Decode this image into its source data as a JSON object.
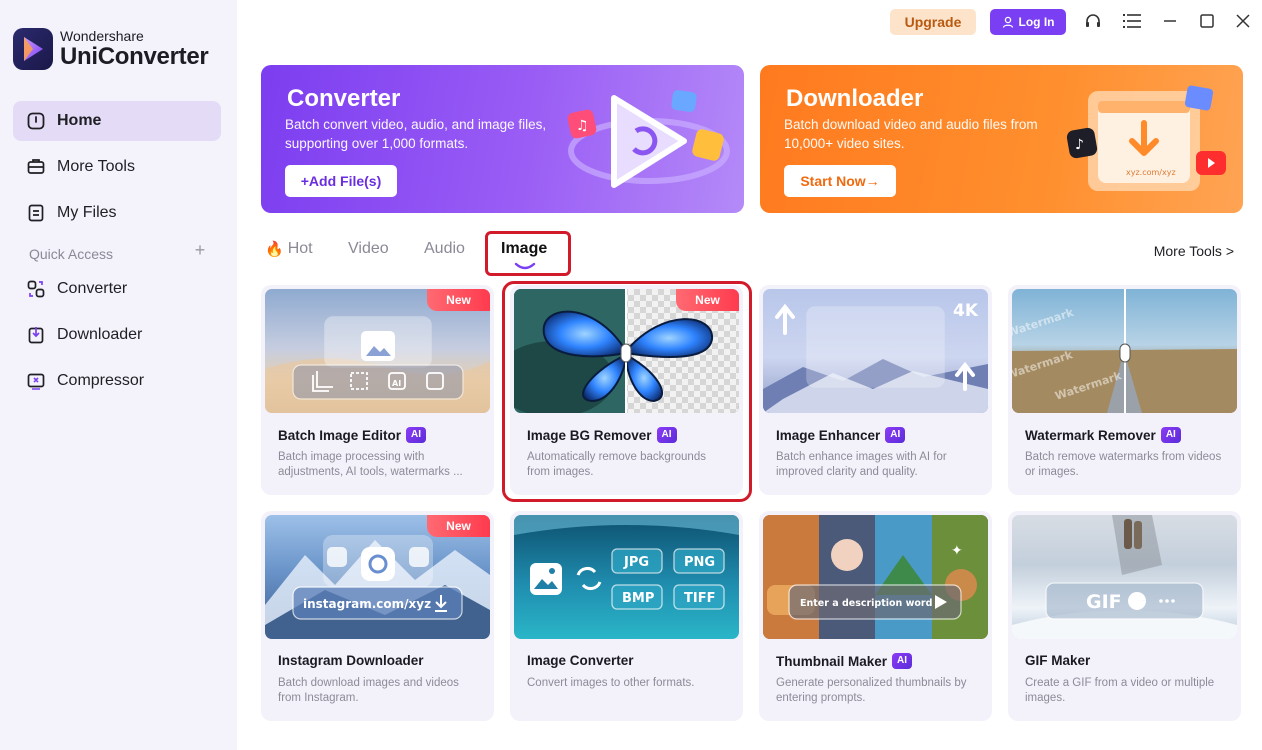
{
  "app": {
    "brand": "Wondershare",
    "product": "UniConverter"
  },
  "titlebar": {
    "upgrade_label": "Upgrade",
    "login_label": "Log In",
    "icons": [
      "headset-icon",
      "menu-icon",
      "minimize-icon",
      "maximize-icon",
      "close-icon"
    ]
  },
  "sidebar": {
    "items": [
      {
        "label": "Home",
        "icon": "home-icon",
        "active": true
      },
      {
        "label": "More Tools",
        "icon": "toolbox-icon"
      },
      {
        "label": "My Files",
        "icon": "files-icon"
      }
    ],
    "quick_access_label": "Quick Access",
    "quick_access_add": "+",
    "quick_items": [
      {
        "label": "Converter",
        "icon": "converter-icon"
      },
      {
        "label": "Downloader",
        "icon": "downloader-icon"
      },
      {
        "label": "Compressor",
        "icon": "compressor-icon"
      }
    ]
  },
  "banners": {
    "converter": {
      "title": "Converter",
      "description": "Batch convert video, audio, and image files, supporting over 1,000 formats.",
      "cta": "+Add File(s)"
    },
    "downloader": {
      "title": "Downloader",
      "description": "Batch download video and audio files from 10,000+ video sites.",
      "cta": "Start Now→",
      "art_url_text": "xyz.com/xyz"
    }
  },
  "tabs": [
    {
      "label": "Hot",
      "icon": "fire-icon"
    },
    {
      "label": "Video"
    },
    {
      "label": "Audio"
    },
    {
      "label": "Image",
      "active": true
    }
  ],
  "more_tools_label": "More Tools >",
  "badges": {
    "new": "New",
    "ai": "AI"
  },
  "cards": [
    {
      "title": "Batch Image Editor",
      "ai": true,
      "new": true,
      "desc": "Batch image processing with adjustments, AI tools, watermarks ..."
    },
    {
      "title": "Image BG Remover",
      "ai": true,
      "new": true,
      "desc": "Automatically remove backgrounds from images."
    },
    {
      "title": "Image Enhancer",
      "ai": true,
      "new": false,
      "desc": "Batch enhance images with AI for improved clarity and quality.",
      "thumb_text": "4K"
    },
    {
      "title": "Watermark Remover",
      "ai": true,
      "new": false,
      "desc": "Batch remove watermarks from videos or images.",
      "thumb_text": "Watermark"
    },
    {
      "title": "Instagram Downloader",
      "ai": false,
      "new": true,
      "desc": "Batch download images and videos from Instagram.",
      "thumb_text": "instagram.com/xyz"
    },
    {
      "title": "Image Converter",
      "ai": false,
      "new": false,
      "desc": "Convert images to other formats.",
      "formats": [
        "JPG",
        "PNG",
        "BMP",
        "TIFF"
      ]
    },
    {
      "title": "Thumbnail Maker",
      "ai": true,
      "new": false,
      "desc": "Generate personalized thumbnails by entering prompts.",
      "thumb_text": "Enter a description word"
    },
    {
      "title": "GIF Maker",
      "ai": false,
      "new": false,
      "desc": "Create a GIF from a video or multiple images.",
      "thumb_text": "GIF"
    }
  ],
  "colors": {
    "accent": "#7a3ff2",
    "highlight": "#d11b2a",
    "upgrade_bg": "#fde3c9",
    "converter_banner": "#8b4ef3",
    "downloader_banner": "#ff8a2a"
  }
}
